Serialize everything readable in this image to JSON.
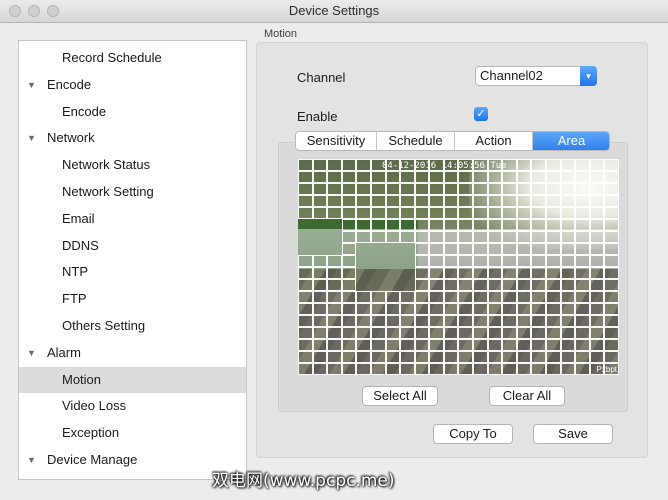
{
  "window": {
    "title": "Device Settings"
  },
  "sidebar": {
    "items": [
      {
        "label": "Record Schedule",
        "level": 1,
        "expanded": null
      },
      {
        "label": "Encode",
        "level": 0,
        "expanded": true
      },
      {
        "label": "Encode",
        "level": 1,
        "expanded": null
      },
      {
        "label": "Network",
        "level": 0,
        "expanded": true
      },
      {
        "label": "Network Status",
        "level": 1,
        "expanded": null
      },
      {
        "label": "Network Setting",
        "level": 1,
        "expanded": null
      },
      {
        "label": "Email",
        "level": 1,
        "expanded": null
      },
      {
        "label": "DDNS",
        "level": 1,
        "expanded": null
      },
      {
        "label": "NTP",
        "level": 1,
        "expanded": null
      },
      {
        "label": "FTP",
        "level": 1,
        "expanded": null
      },
      {
        "label": "Others Setting",
        "level": 1,
        "expanded": null
      },
      {
        "label": "Alarm",
        "level": 0,
        "expanded": true
      },
      {
        "label": "Motion",
        "level": 1,
        "expanded": null,
        "selected": true
      },
      {
        "label": "Video Loss",
        "level": 1,
        "expanded": null
      },
      {
        "label": "Exception",
        "level": 1,
        "expanded": null
      },
      {
        "label": "Device Manage",
        "level": 0,
        "expanded": true
      }
    ]
  },
  "main": {
    "section_title": "Motion",
    "channel_label": "Channel",
    "channel_value": "Channel02",
    "enable_label": "Enable",
    "enable_checked": true,
    "tabs": [
      {
        "label": "Sensitivity",
        "active": false
      },
      {
        "label": "Schedule",
        "active": false
      },
      {
        "label": "Action",
        "active": false
      },
      {
        "label": "Area",
        "active": true
      }
    ],
    "camera": {
      "osd_text": "04-12-2016 14:05:56 Tue",
      "camera_label": "Pxbpt"
    },
    "select_all_label": "Select All",
    "clear_all_label": "Clear All",
    "copy_to_label": "Copy To",
    "save_label": "Save"
  },
  "watermark": "双电网(www.pcpc.me)",
  "colors": {
    "accent": "#2f80ee",
    "selection": "#dcdcdc"
  }
}
